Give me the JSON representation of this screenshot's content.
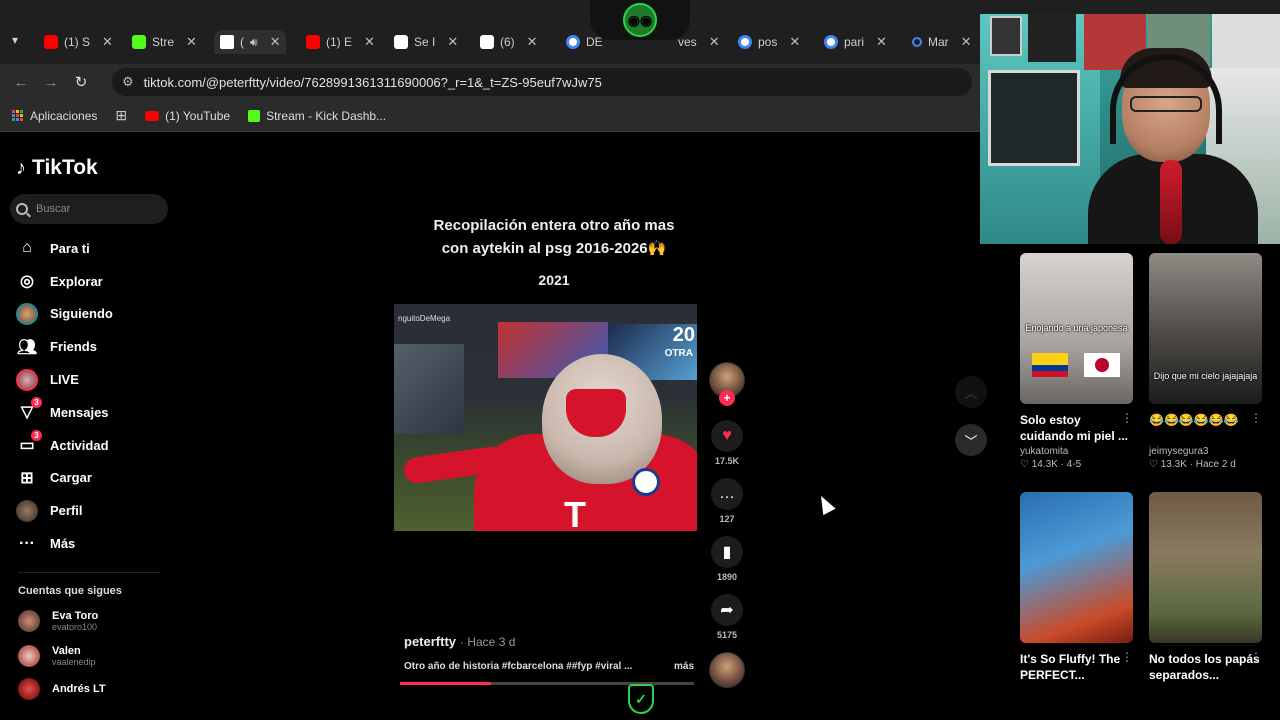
{
  "browser": {
    "tabs": [
      {
        "label": "(1) S",
        "icon": "youtube-icon",
        "color": "#ff0000"
      },
      {
        "label": "Stre",
        "icon": "kick-icon",
        "color": "#53fc18"
      },
      {
        "label": "(",
        "icon": "tiktok-icon",
        "color": "#ffffff",
        "audio": true
      },
      {
        "label": "(1) E",
        "icon": "youtube-icon",
        "color": "#ff0000"
      },
      {
        "label": "Se I",
        "icon": "tiktok-icon",
        "color": "#ffffff"
      },
      {
        "label": "(6)",
        "icon": "tiktok-icon",
        "color": "#ffffff"
      },
      {
        "label": "DE",
        "icon": "google-icon",
        "color": "#4285f4"
      },
      {
        "label": "ves",
        "icon": "none",
        "color": "#1f1f1f"
      },
      {
        "label": "pos",
        "icon": "google-icon",
        "color": "#4285f4"
      },
      {
        "label": "pari",
        "icon": "google-icon",
        "color": "#4285f4"
      },
      {
        "label": "Mar",
        "icon": "loading-icon",
        "color": "#4285f4"
      }
    ],
    "url": "tiktok.com/@peterftty/video/7628991361311690006?_r=1&_t=ZS-95euf7wJw75",
    "bookmarks": [
      {
        "label": "Aplicaciones",
        "icon": "apps-grid-icon"
      },
      {
        "label": "",
        "icon": "tab-groups-icon"
      },
      {
        "label": "(1) YouTube",
        "icon": "youtube-icon"
      },
      {
        "label": "Stream - Kick Dashb...",
        "icon": "kick-icon"
      }
    ]
  },
  "tiktok": {
    "logo_text": "TikTok",
    "search_placeholder": "Buscar",
    "nav": [
      {
        "label": "Para ti",
        "icon": "home-icon"
      },
      {
        "label": "Explorar",
        "icon": "compass-icon"
      },
      {
        "label": "Siguiendo",
        "icon": "following-avatar-icon"
      },
      {
        "label": "Friends",
        "icon": "friends-icon"
      },
      {
        "label": "LIVE",
        "icon": "live-avatar-icon"
      },
      {
        "label": "Mensajes",
        "icon": "messages-icon",
        "badge": "3"
      },
      {
        "label": "Actividad",
        "icon": "activity-icon",
        "badge": "3"
      },
      {
        "label": "Cargar",
        "icon": "upload-icon"
      },
      {
        "label": "Perfil",
        "icon": "profile-avatar-icon"
      },
      {
        "label": "Más",
        "icon": "more-icon"
      }
    ],
    "following_title": "Cuentas que sigues",
    "following": [
      {
        "name": "Eva Toro",
        "handle": "evatoro100"
      },
      {
        "name": "Valen",
        "handle": "vaalenedip"
      },
      {
        "name": "Andrés LT",
        "handle": ""
      }
    ]
  },
  "video": {
    "title_line1": "Recopilación entera otro año mas",
    "title_line2": "con aytekin al psg 2016-2026🙌",
    "year": "2021",
    "frame_text_num": "20",
    "frame_text_otra": "OTRA",
    "frame_watermark": "nguitoDeMega",
    "frame_shirt_letter": "T",
    "username": "peterftty",
    "time": "· Hace 3 d",
    "description": "Otro año de historia #fcbarcelona ##fyp #viral ...",
    "more": "más",
    "progress": 0.31,
    "likes": "17.5K",
    "comments": "127",
    "saves": "1890",
    "shares": "5175"
  },
  "recommended": [
    {
      "title": "Solo estoy cuidando mi piel ...",
      "author": "yukatomita",
      "stats": "♡ 14.3K · 4-5",
      "caption": "Enojando a una japonesa"
    },
    {
      "title": "😂😂😂😂😂😂",
      "author": "jeimysegura3",
      "stats": "♡ 13.3K · Hace 2 d",
      "caption": "Dijo que mi cielo jajajajaja"
    },
    {
      "title": "It's So Fluffy! The PERFECT...",
      "author": "",
      "stats": "",
      "caption": ""
    },
    {
      "title": "No todos los papás separados...",
      "author": "",
      "stats": "",
      "caption": ""
    }
  ],
  "colors": {
    "tiktok_accent": "#fe2c55",
    "brand_green": "#2fd34a"
  }
}
